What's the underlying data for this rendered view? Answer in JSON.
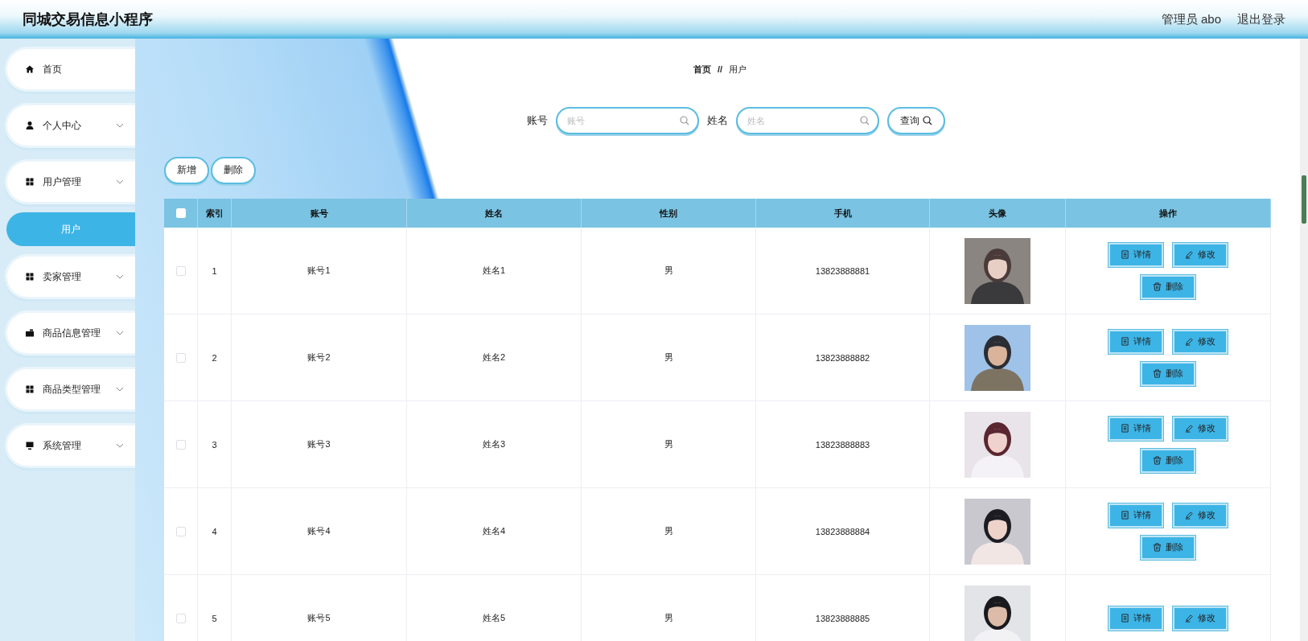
{
  "header": {
    "title": "同城交易信息小程序",
    "user": "管理员 abo",
    "logout": "退出登录"
  },
  "sidebar": {
    "items": [
      {
        "label": "首页"
      },
      {
        "label": "个人中心",
        "chevron": true
      },
      {
        "label": "用户管理",
        "chevron": true,
        "children": [
          {
            "label": "用户",
            "selected": true
          }
        ]
      },
      {
        "label": "卖家管理",
        "chevron": true
      },
      {
        "label": "商品信息管理",
        "chevron": true
      },
      {
        "label": "商品类型管理",
        "chevron": true
      },
      {
        "label": "系统管理",
        "chevron": true
      }
    ]
  },
  "breadcrumb": {
    "home": "首页",
    "separator": "//",
    "current": "用户"
  },
  "search": {
    "fields": [
      {
        "label": "账号",
        "placeholder": "账号"
      },
      {
        "label": "姓名",
        "placeholder": "姓名"
      }
    ],
    "button": "查询"
  },
  "toolbar": [
    "新增",
    "删除"
  ],
  "table": {
    "select_all": {
      "checked": false
    },
    "columns": [
      "索引",
      "账号",
      "姓名",
      "性别",
      "手机",
      "头像",
      "操作"
    ],
    "rows": [
      {
        "checked": false,
        "index": "1",
        "account": "账号1",
        "name": "姓名1",
        "gender": "男",
        "phone": "13823888881",
        "avatar": {
          "kind": "picture"
        },
        "actions": [
          "详情",
          "修改",
          "删除"
        ]
      },
      {
        "checked": false,
        "index": "2",
        "account": "账号2",
        "name": "姓名2",
        "gender": "男",
        "phone": "13823888882",
        "avatar": {
          "kind": "picture"
        },
        "actions": [
          "详情",
          "修改",
          "删除"
        ]
      },
      {
        "checked": false,
        "index": "3",
        "account": "账号3",
        "name": "姓名3",
        "gender": "男",
        "phone": "13823888883",
        "avatar": {
          "kind": "picture"
        },
        "actions": [
          "详情",
          "修改",
          "删除"
        ]
      },
      {
        "checked": false,
        "index": "4",
        "account": "账号4",
        "name": "姓名4",
        "gender": "男",
        "phone": "13823888884",
        "avatar": {
          "kind": "picture"
        },
        "actions": [
          "详情",
          "修改",
          "删除"
        ]
      },
      {
        "checked": false,
        "index": "5",
        "account": "账号5",
        "name": "姓名5",
        "gender": "男",
        "phone": "13823888885",
        "avatar": {
          "kind": "picture"
        },
        "actions": [
          "详情",
          "修改"
        ]
      }
    ]
  }
}
